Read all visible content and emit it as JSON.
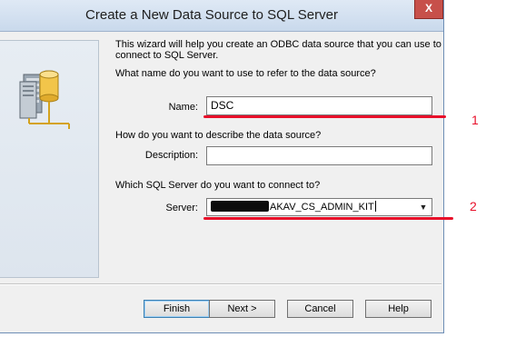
{
  "window": {
    "title": "Create a New Data Source to SQL Server",
    "close_label": "X"
  },
  "intro": {
    "line1": "This wizard will help you create an ODBC data source that you can use to",
    "line2": "connect to SQL Server.",
    "name_question": "What name do you want to use to refer to the data source?"
  },
  "fields": {
    "name_label": "Name:",
    "name_value": "DSC",
    "description_question": "How do you want to describe the data source?",
    "description_label": "Description:",
    "description_value": "",
    "server_question": "Which SQL Server do you want to connect to?",
    "server_label": "Server:",
    "server_value": "AKAV_CS_ADMIN_KIT"
  },
  "buttons": {
    "finish": "Finish",
    "next": "Next >",
    "cancel": "Cancel",
    "help": "Help"
  },
  "annotations": {
    "marker1": "1",
    "marker2": "2",
    "color": "#e8102a"
  },
  "icons": {
    "close": "close-icon",
    "dropdown": "chevron-down-icon",
    "server_image": "server-database-icon"
  }
}
